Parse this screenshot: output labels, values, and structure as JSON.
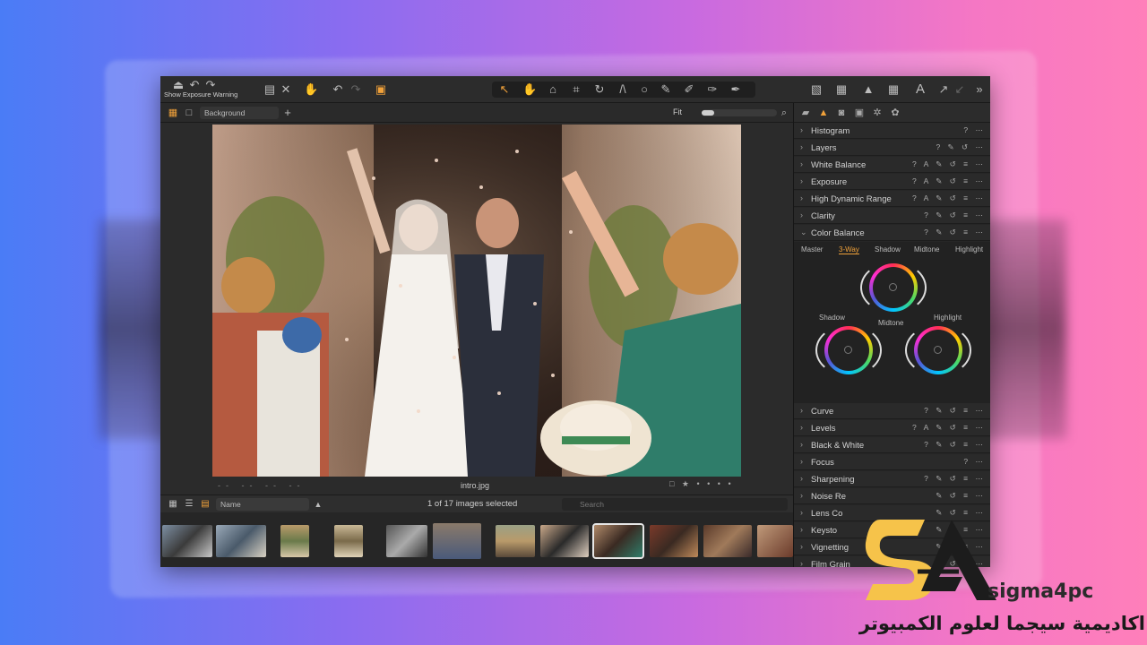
{
  "toolbar": {
    "exposure_warning_label": "Show Exposure Warning"
  },
  "viewer": {
    "background_select": "Background",
    "zoom_label": "Fit",
    "filename": "intro.jpg",
    "meta_dashes": "-- -- -- --"
  },
  "browser": {
    "sort_select": "Name",
    "selection_count": "1 of 17 images selected",
    "search_placeholder": "Search"
  },
  "tools": {
    "histogram": "Histogram",
    "layers": "Layers",
    "white_balance": "White Balance",
    "exposure": "Exposure",
    "hdr": "High Dynamic Range",
    "clarity": "Clarity",
    "color_balance": "Color Balance",
    "curve": "Curve",
    "levels": "Levels",
    "bw": "Black & White",
    "focus": "Focus",
    "sharpening": "Sharpening",
    "noise": "Noise Re",
    "lens": "Lens Co",
    "keystone": "Keysto",
    "vignetting": "Vignetting",
    "film_grain": "Film Grain"
  },
  "color_balance": {
    "tabs": [
      "Master",
      "3-Way",
      "Shadow",
      "Midtone",
      "Highlight"
    ],
    "active_tab": "3-Way",
    "wheel_labels": {
      "shadow": "Shadow",
      "midtone": "Midtone",
      "highlight": "Highlight"
    }
  },
  "brand": {
    "latin": "sigma4pc",
    "arabic": "اكاديمية سيجما لعلوم الكمبيوتر"
  },
  "colors": {
    "accent": "#f0a13a",
    "panel_bg": "#262626",
    "app_bg": "#242424"
  }
}
